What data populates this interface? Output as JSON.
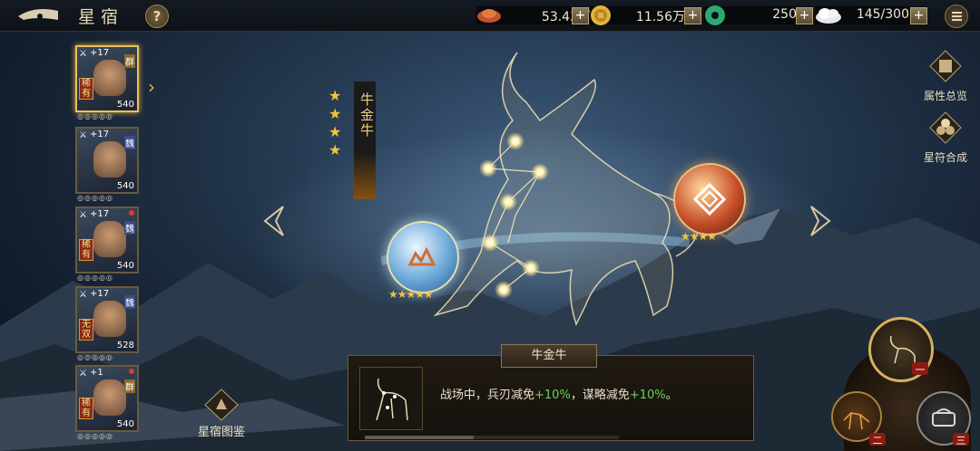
{
  "header": {
    "title": "星宿",
    "help_label": "?",
    "resources": [
      {
        "name": "copper",
        "icon": "copper-ingot-icon",
        "value": "53.43万"
      },
      {
        "name": "coins",
        "icon": "gold-coin-icon",
        "value": "11.56万"
      },
      {
        "name": "jade",
        "icon": "jade-icon",
        "value": "250"
      },
      {
        "name": "stamina",
        "icon": "stamina-icon",
        "value": "145/300"
      }
    ],
    "plus_label": "+"
  },
  "heroes": [
    {
      "level": "+17",
      "faction": "群",
      "tag": "稀有",
      "power": "540",
      "selected": true,
      "red_dot": false
    },
    {
      "level": "+17",
      "faction": "魏",
      "tag": "",
      "power": "540",
      "selected": false,
      "red_dot": false
    },
    {
      "level": "+17",
      "faction": "魏",
      "tag": "稀有",
      "power": "540",
      "selected": false,
      "red_dot": true
    },
    {
      "level": "+17",
      "faction": "魏",
      "tag": "无双",
      "power": "528",
      "selected": false,
      "red_dot": false
    },
    {
      "level": "+1",
      "faction": "群",
      "tag": "稀有",
      "power": "540",
      "selected": false,
      "red_dot": true
    }
  ],
  "constellation": {
    "name": "牛金牛",
    "rating_stars": 4,
    "left_orb_stars": 5,
    "right_orb_stars": 4,
    "star_glyph": "★"
  },
  "side_buttons": {
    "attributes": "属性总览",
    "synthesis": "星符合成"
  },
  "gallery_label": "星宿图鉴",
  "panel": {
    "title": "牛金牛",
    "desc_prefix": "战场中，兵刃减免",
    "value1": "+10%",
    "desc_mid": "，谋略减免",
    "value2": "+10%",
    "desc_suffix": "。"
  },
  "wheel": {
    "labels": [
      "一",
      "二",
      "三"
    ]
  }
}
